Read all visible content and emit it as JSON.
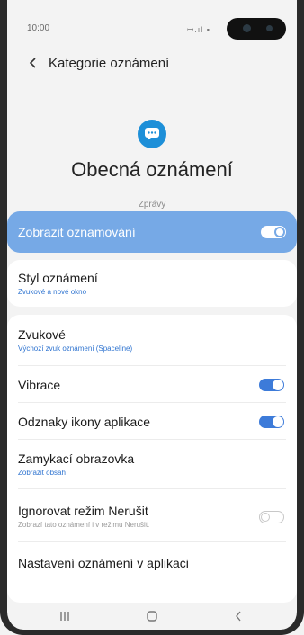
{
  "status_bar": {
    "time": "10:00",
    "icons": "ꟷ.ıl ▪"
  },
  "header": {
    "back_label": "<",
    "title": "Kategorie oznámení"
  },
  "page": {
    "title": "Obecná oznámení",
    "subtitle": "Zprávy"
  },
  "master_toggle": {
    "label": "Zobrazit oznamování",
    "state": "on"
  },
  "notification_style": {
    "title": "Styl oznámení",
    "value": "Zvukové a nové okno"
  },
  "settings": {
    "sound": {
      "title": "Zvukové",
      "value": "Výchozí zvuk oznámení (Spaceline)"
    },
    "vibration": {
      "title": "Vibrace",
      "state": "on"
    },
    "badges": {
      "title": "Odznaky ikony aplikace",
      "state": "on"
    },
    "lock_screen": {
      "title": "Zamykací obrazovka",
      "value": "Zobrazit obsah"
    },
    "dnd": {
      "title": "Ignorovat režim Nerušit",
      "value": "Zobrazí tato oznámení i v režimu Nerušit.",
      "state": "off"
    },
    "app_settings": {
      "title": "Nastavení oznámení v aplikaci"
    }
  },
  "nav": {
    "recents": "|||",
    "home": "O",
    "back": "<"
  },
  "colors": {
    "accent": "#3d7bd9",
    "master_bg": "#76a9e6",
    "app_icon": "#1d8fd8"
  }
}
